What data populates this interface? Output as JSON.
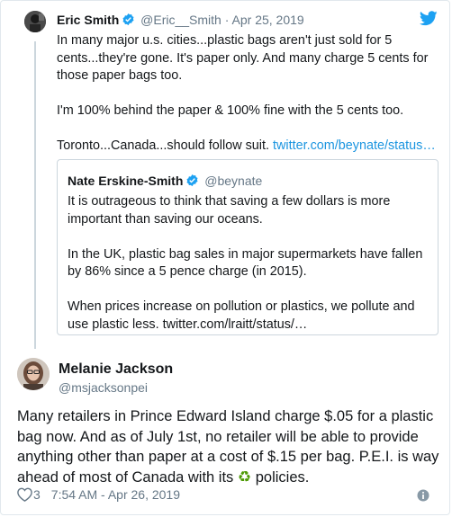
{
  "parent_tweet": {
    "name": "Eric Smith",
    "handle": "@Eric__Smith",
    "separator": "·",
    "date": "Apr 25, 2019",
    "paragraphs": [
      "In many major u.s. cities...plastic bags aren't just sold for 5 cents...they're gone.  It's paper only.  And many charge 5 cents for those paper bags too.",
      "I'm 100% behind the paper & 100% fine with the 5 cents too."
    ],
    "last_text": "Toronto...Canada...should follow suit. ",
    "link_text": "twitter.com/beynate/status…"
  },
  "quoted_tweet": {
    "name": "Nate Erskine-Smith",
    "handle": "@beynate",
    "paragraphs": [
      "It is outrageous to think that saving a few dollars is more important than saving our oceans.",
      "In the UK, plastic bag sales in major supermarkets have fallen by 86% since a 5 pence charge (in 2015)."
    ],
    "last_paragraph": "When prices increase on pollution or plastics, we pollute and use plastic less. twitter.com/lraitt/status/…"
  },
  "main_tweet": {
    "name": "Melanie Jackson",
    "handle": "@msjacksonpei",
    "text_before_emoji": "Many retailers in Prince Edward Island charge $.05 for a plastic bag now. And as of July 1st, no retailer will be able to provide anything other than paper at a cost of $.15 per bag. P.E.I. is way ahead of most of Canada with its ",
    "emoji": "♻",
    "text_after_emoji": " policies."
  },
  "footer": {
    "like_count": "3",
    "timestamp": "7:54 AM - Apr 26, 2019"
  },
  "icons": {
    "verified": "verified-badge-icon",
    "twitter": "twitter-bird-icon",
    "like": "heart-icon",
    "info": "info-icon",
    "emoji": "recycle-icon"
  },
  "colors": {
    "link": "#1b95e0",
    "verified": "#1da1f2",
    "twitter_bird": "#1da1f2",
    "muted": "#657786",
    "recycle": "#4e9a06"
  }
}
